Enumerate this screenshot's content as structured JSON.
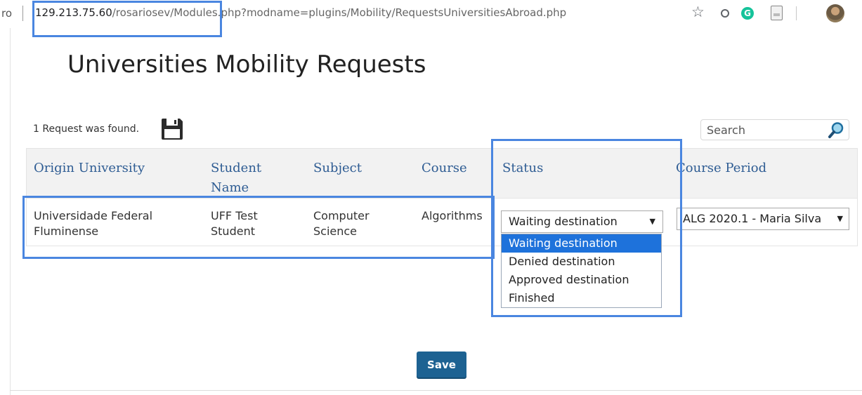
{
  "browser": {
    "prefix": "ro",
    "url_host": "129.213.75.60",
    "url_path": "/rosariosev/Modules.php?modname=plugins/Mobility/RequestsUniversitiesAbroad.php",
    "extension_g": "G"
  },
  "page": {
    "title": "Universities Mobility Requests",
    "found_text": "1 Request was found.",
    "search_placeholder": "Search"
  },
  "table": {
    "headers": {
      "origin": "Origin University",
      "student": "Student Name",
      "subject": "Subject",
      "course": "Course",
      "status": "Status",
      "period": "Course Period"
    },
    "row": {
      "origin": "Universidade Federal Fluminense",
      "student": "UFF Test Student",
      "subject": "Computer Science",
      "course": "Algorithms",
      "status": "Waiting destination",
      "period": "ALG 2020.1 - Maria Silva"
    }
  },
  "status_options": [
    "Waiting destination",
    "Denied destination",
    "Approved destination",
    "Finished"
  ],
  "actions": {
    "save": "Save"
  },
  "colors": {
    "header_text": "#2e5c93",
    "save_button": "#1d6292",
    "highlight": "#4a86e0",
    "selected_option": "#1e72db"
  }
}
